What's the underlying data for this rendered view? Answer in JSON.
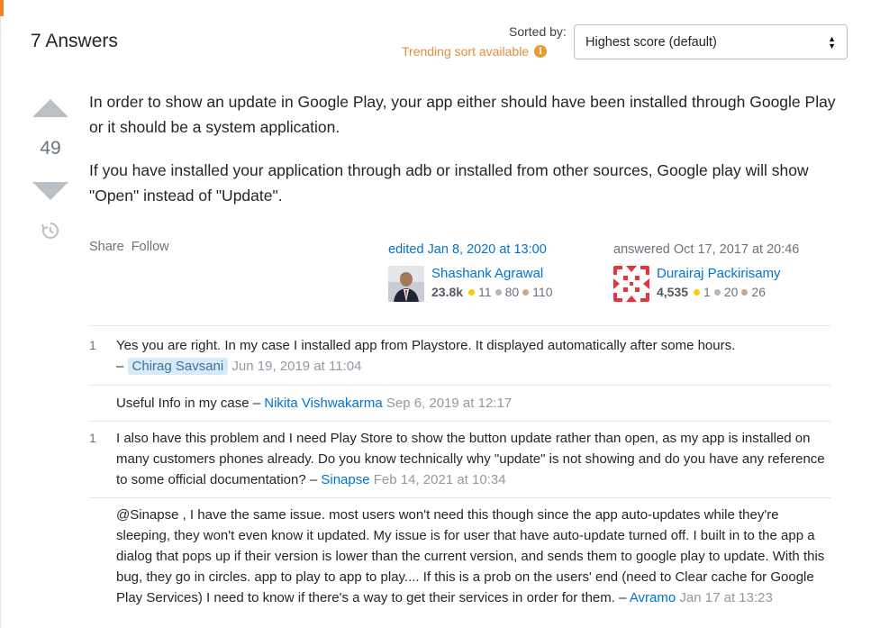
{
  "header": {
    "answers_count": "7 Answers",
    "sorted_by_label": "Sorted by:",
    "trending_text": "Trending sort available",
    "sort_value": "Highest score (default)"
  },
  "answer": {
    "score": "49",
    "paragraphs": [
      "In order to show an update in Google Play, your app either should have been installed through Google Play or it should be a system application.",
      "If you have installed your application through adb or installed from other sources, Google play will show \"Open\" instead of \"Update\"."
    ],
    "actions": {
      "share": "Share",
      "follow": "Follow"
    },
    "editor": {
      "action": "edited Jan 8, 2020 at 13:00",
      "name": "Shashank Agrawal",
      "rep": "23.8k",
      "gold": "11",
      "silver": "80",
      "bronze": "110"
    },
    "author": {
      "action": "answered Oct 17, 2017 at 20:46",
      "name": "Durairaj Packirisamy",
      "rep": "4,535",
      "gold": "1",
      "silver": "20",
      "bronze": "26"
    }
  },
  "comments": [
    {
      "score": "1",
      "text": "Yes you are right. In my case I installed app from Playstore. It displayed automatically after some hours.",
      "sep": " – ",
      "user": "Chirag Savsani",
      "date": "Jun 19, 2019 at 11:04"
    },
    {
      "score": "",
      "text": "Useful Info in my case",
      "sep": " – ",
      "user": "Nikita Vishwakarma",
      "date": "Sep 6, 2019 at 12:17"
    },
    {
      "score": "1",
      "text": "I also have this problem and I need Play Store to show the button update rather than open, as my app is installed on many customers phones already. Do you know technically why \"update\" is not showing and do you have any reference to some official documentation?",
      "sep": " – ",
      "user": "Sinapse",
      "date": "Feb 14, 2021 at 10:34"
    },
    {
      "score": "",
      "text": "@Sinapse , I have the same issue. most users won't need this though since the app auto-updates while they're sleeping, they won't even know it updated. My issue is for user that have auto-update turned off. I built in to the app a dialog that pops up if their version is lower than the current version, and sends them to google play to update. With this bug, they go in circles. app to play to app to play.... If this is a prob on the users' end (need to Clear cache for Google Play Services) I need to know if there's a way to get their services in order for them.",
      "sep": " – ",
      "user": "Avramo",
      "date": "Jan 17 at 13:23"
    }
  ],
  "colors": {
    "link": "#0074cc",
    "trending": "#e09038",
    "vote_arrow": "#bbc0c4",
    "gold": "#ffcc01",
    "silver": "#b4b8bc",
    "bronze": "#d1a684"
  }
}
